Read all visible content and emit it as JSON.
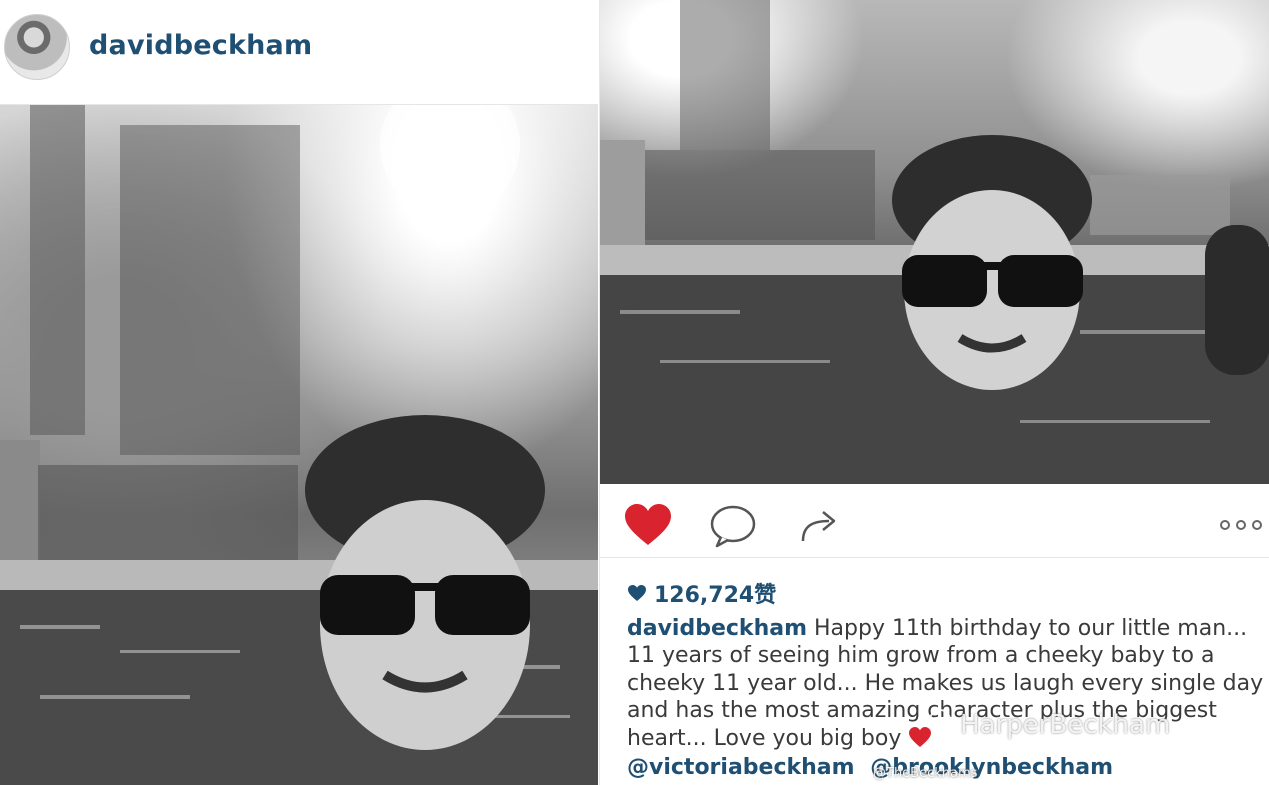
{
  "left_post": {
    "username": "davidbeckham"
  },
  "right_post": {
    "likes_count": "126,724赞",
    "caption": {
      "username": "davidbeckham",
      "text": "Happy 11th birthday to our little man... 11 years of seeing him grow from a cheeky baby to a cheeky 11 year old... He makes us laugh every single day and has the most amazing character plus the biggest heart... Love you big boy"
    },
    "mentions": [
      "@victoriabeckham",
      "@brooklynbeckham"
    ]
  },
  "watermark": {
    "main": "HarperBeckham",
    "sub": "@TheBeckhams"
  },
  "icons": {
    "like": "heart-filled-icon",
    "comment": "speech-bubble-icon",
    "share": "share-arrow-icon",
    "more": "ellipsis-icon",
    "caption_emoji": "red-heart-icon"
  },
  "colors": {
    "username": "#1f4f72",
    "like_red": "#d9242f"
  }
}
